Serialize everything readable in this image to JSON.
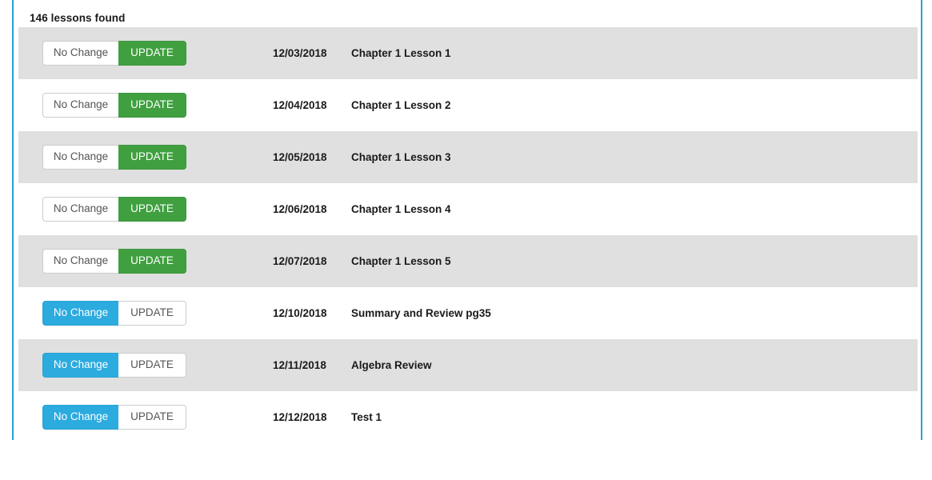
{
  "panel": {
    "results_count_label": "146 lessons found",
    "accent_border_color": "#2a9fd6",
    "stripe_color": "#e0e0e0",
    "row_background_color": "#ffffff"
  },
  "buttons": {
    "no_change_label": "No Change",
    "update_label": "UPDATE",
    "update_active_color": "#40a040",
    "no_change_active_color": "#2cabdf",
    "inactive_background_color": "#ffffff",
    "inactive_text_color": "#555555"
  },
  "lessons": [
    {
      "date": "12/03/2018",
      "title": "Chapter 1 Lesson 1",
      "no_change_active": false,
      "update_active": true,
      "striped": true
    },
    {
      "date": "12/04/2018",
      "title": "Chapter 1 Lesson 2",
      "no_change_active": false,
      "update_active": true,
      "striped": false
    },
    {
      "date": "12/05/2018",
      "title": "Chapter 1 Lesson 3",
      "no_change_active": false,
      "update_active": true,
      "striped": true
    },
    {
      "date": "12/06/2018",
      "title": "Chapter 1 Lesson 4",
      "no_change_active": false,
      "update_active": true,
      "striped": false
    },
    {
      "date": "12/07/2018",
      "title": "Chapter 1 Lesson 5",
      "no_change_active": false,
      "update_active": true,
      "striped": true
    },
    {
      "date": "12/10/2018",
      "title": "Summary and Review pg35",
      "no_change_active": true,
      "update_active": false,
      "striped": false
    },
    {
      "date": "12/11/2018",
      "title": "Algebra Review",
      "no_change_active": true,
      "update_active": false,
      "striped": true
    },
    {
      "date": "12/12/2018",
      "title": "Test 1",
      "no_change_active": true,
      "update_active": false,
      "striped": false
    }
  ]
}
